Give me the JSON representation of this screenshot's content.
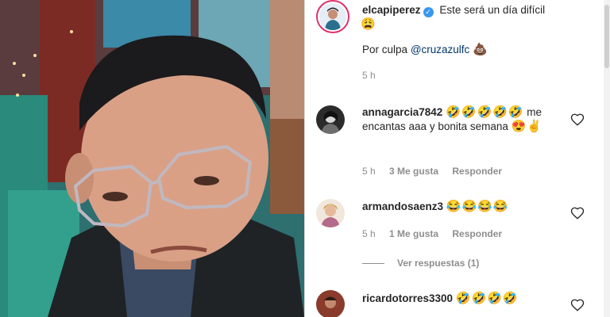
{
  "post": {
    "username": "elcapiperez",
    "caption_line1": "Este será un día difícil",
    "caption_emoji1": "😩",
    "caption_line2_prefix": "Por culpa",
    "caption_mention": "@cruzazulfc",
    "caption_emoji2": "💩",
    "time": "5 h"
  },
  "comments": [
    {
      "username": "annagarcia7842",
      "text_emojis": "🤣🤣🤣🤣🤣",
      "text": "me encantas aaa y bonita semana",
      "text_trailing": "😍✌",
      "time": "5 h",
      "likes": "3 Me gusta",
      "reply": "Responder"
    },
    {
      "username": "armandosaenz3",
      "text_emojis": "😂😂😂😂",
      "time": "5 h",
      "likes": "1 Me gusta",
      "reply": "Responder"
    },
    {
      "username": "ricardotorres3300",
      "text_emojis": "🤣🤣🤣🤣"
    }
  ],
  "view_replies": "Ver respuestas (1)",
  "colors": {
    "mention": "#00376b",
    "meta": "#8e8e8e",
    "verified": "#3897f0",
    "story_ring": "#e1306c"
  }
}
